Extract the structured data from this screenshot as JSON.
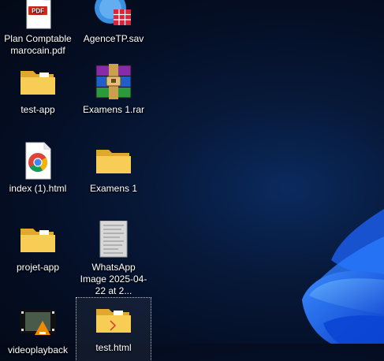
{
  "desktop": {
    "icons": [
      {
        "label": "Plan Comptable marocain.pdf",
        "type": "pdf-icon"
      },
      {
        "label": "AgenceTP.sav",
        "type": "spss-file-icon"
      },
      {
        "label": "test-app",
        "type": "folder-icon"
      },
      {
        "label": "Examens 1.rar",
        "type": "winrar-archive-icon"
      },
      {
        "label": "index (1).html",
        "type": "chrome-html-icon"
      },
      {
        "label": "Examens 1",
        "type": "folder-icon"
      },
      {
        "label": "projet-app",
        "type": "folder-icon"
      },
      {
        "label": "WhatsApp Image 2025-04-22 at 2...",
        "type": "image-thumbnail-icon"
      },
      {
        "label": "videoplayback",
        "type": "video-file-icon"
      },
      {
        "label": "test.html",
        "type": "folder-icon"
      }
    ],
    "pdf_badge": "PDF",
    "selected_icon": "test.html"
  },
  "colors": {
    "folder": "#f5c542",
    "wallpaper_accent": "#1a6dff",
    "background": "#040d22"
  }
}
